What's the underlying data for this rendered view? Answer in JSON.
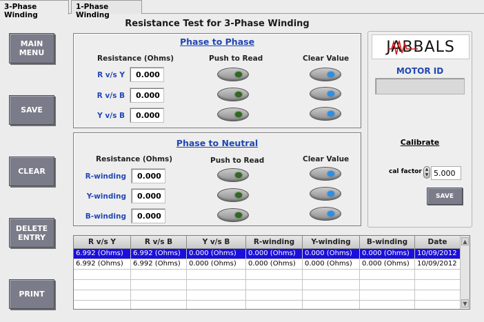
{
  "tabs": [
    {
      "label": "3-Phase Winding"
    },
    {
      "label": "1-Phase Winding"
    }
  ],
  "title": "Resistance Test for 3-Phase Winding",
  "sidebar": {
    "main_menu": "MAIN\nMENU",
    "save": "SAVE",
    "clear": "CLEAR",
    "delete_entry": "DELETE\nENTRY",
    "print": "PRINT"
  },
  "phase_to_phase": {
    "title": "Phase to Phase",
    "col_resistance": "Resistance (Ohms)",
    "col_push": "Push to Read",
    "col_clear": "Clear Value",
    "rows": [
      {
        "label": "R v/s Y",
        "value": "0.000"
      },
      {
        "label": "R v/s B",
        "value": "0.000"
      },
      {
        "label": "Y v/s B",
        "value": "0.000"
      }
    ]
  },
  "phase_to_neutral": {
    "title": "Phase to Neutral",
    "col_resistance": "Resistance (Ohms)",
    "col_push": "Push to Read",
    "col_clear": "Clear Value",
    "rows": [
      {
        "label": "R-winding",
        "value": "0.000"
      },
      {
        "label": "Y-winding",
        "value": "0.000"
      },
      {
        "label": "B-winding",
        "value": "0.000"
      }
    ]
  },
  "right_panel": {
    "logo": "JABBALS",
    "motor_id_label": "MOTOR ID",
    "motor_id_value": "",
    "calibrate_label": "Calibrate",
    "cal_factor_label": "cal factor",
    "cal_factor_value": "5.000",
    "save_label": "SAVE"
  },
  "table": {
    "headers": [
      "R v/s Y",
      "R v/s B",
      "Y v/s B",
      "R-winding",
      "Y-winding",
      "B-winding",
      "Date"
    ],
    "rows": [
      [
        "6.992 (Ohms)",
        "6.992 (Ohms)",
        "0.000 (Ohms)",
        "0.000 (Ohms)",
        "0.000 (Ohms)",
        "0.000 (Ohms)",
        "10/09/2012"
      ],
      [
        "6.992 (Ohms)",
        "6.992 (Ohms)",
        "0.000 (Ohms)",
        "0.000 (Ohms)",
        "0.000 (Ohms)",
        "0.000 (Ohms)",
        "10/09/2012"
      ],
      [
        "",
        "",
        "",
        "",
        "",
        "",
        ""
      ],
      [
        "",
        "",
        "",
        "",
        "",
        "",
        ""
      ],
      [
        "",
        "",
        "",
        "",
        "",
        "",
        ""
      ],
      [
        "",
        "",
        "",
        "",
        "",
        "",
        ""
      ]
    ],
    "selected_row": 0
  },
  "colors": {
    "accent_blue": "#1f47b3",
    "button_gray": "#7a7c89",
    "selection": "#1a0fdc",
    "read_indicator": "#2f6a1e",
    "clear_indicator": "#2c8fe6"
  }
}
